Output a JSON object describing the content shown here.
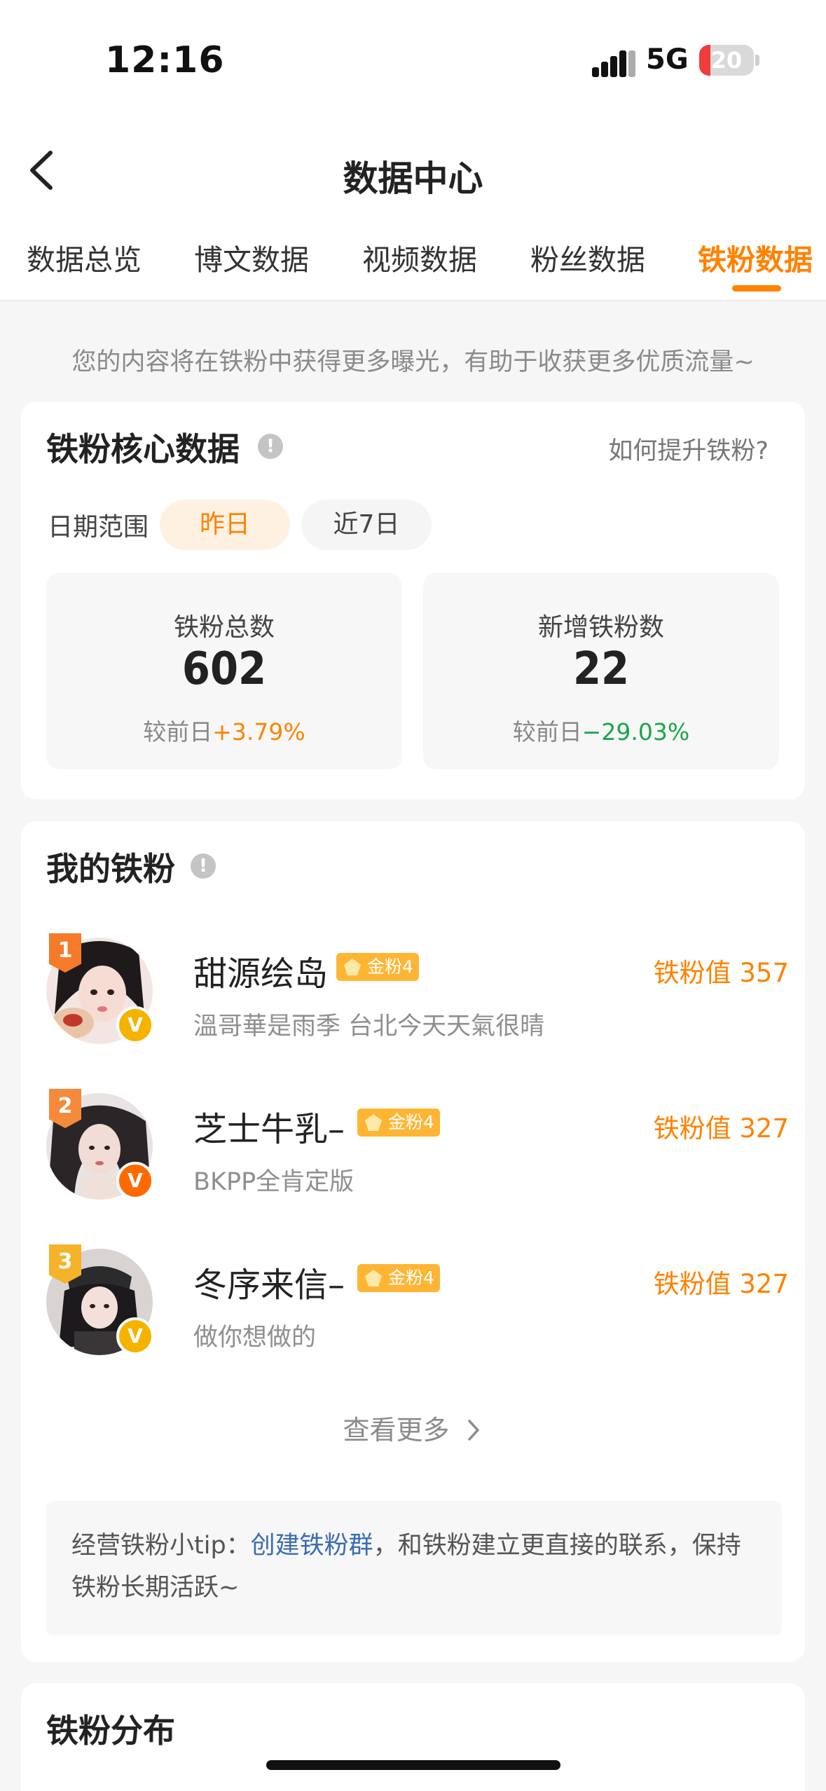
{
  "status_bar": {
    "time": "12:16",
    "network": "5G",
    "battery": "20",
    "battery_level": 0.2
  },
  "nav": {
    "title": "数据中心"
  },
  "tabs": [
    {
      "label": "数据总览",
      "active": false
    },
    {
      "label": "博文数据",
      "active": false
    },
    {
      "label": "视频数据",
      "active": false
    },
    {
      "label": "粉丝数据",
      "active": false
    },
    {
      "label": "铁粉数据",
      "active": true
    }
  ],
  "hint": "您的内容将在铁粉中获得更多曝光，有助于收获更多优质流量~",
  "core": {
    "title": "铁粉核心数据",
    "link": "如何提升铁粉?",
    "date_label": "日期范围",
    "date_options": [
      "昨日",
      "近7日"
    ],
    "stats": [
      {
        "label": "铁粉总数",
        "value": "602",
        "compare_label": "较前日",
        "change": "+3.79%"
      },
      {
        "label": "新增铁粉数",
        "value": "22",
        "compare_label": "较前日",
        "change": "−29.03%"
      }
    ]
  },
  "my_fans": {
    "title": "我的铁粉",
    "items": [
      {
        "rank": "1",
        "name": "甜源绘岛",
        "badge": "金粉4",
        "value": "铁粉值 357",
        "desc": "溫哥華是雨季 台北今天天氣很晴",
        "rank_color": "#f57a2a",
        "v_color": "#f5b300"
      },
      {
        "rank": "2",
        "name": "芝士牛乳–",
        "badge": "金粉4",
        "value": "铁粉值 327",
        "desc": "BKPP全肯定版",
        "rank_color": "#f58a3a",
        "v_color": "#ff6a00"
      },
      {
        "rank": "3",
        "name": "冬序来信–",
        "badge": "金粉4",
        "value": "铁粉值 327",
        "desc": "做你想做的",
        "rank_color": "#f5b32a",
        "v_color": "#f5b300"
      }
    ],
    "more": "查看更多",
    "tip_prefix": "经营铁粉小tip：",
    "tip_link": "创建铁粉群",
    "tip_suffix": "，和铁粉建立更直接的联系，保持铁粉长期活跃~"
  },
  "distribution": {
    "title": "铁粉分布"
  }
}
